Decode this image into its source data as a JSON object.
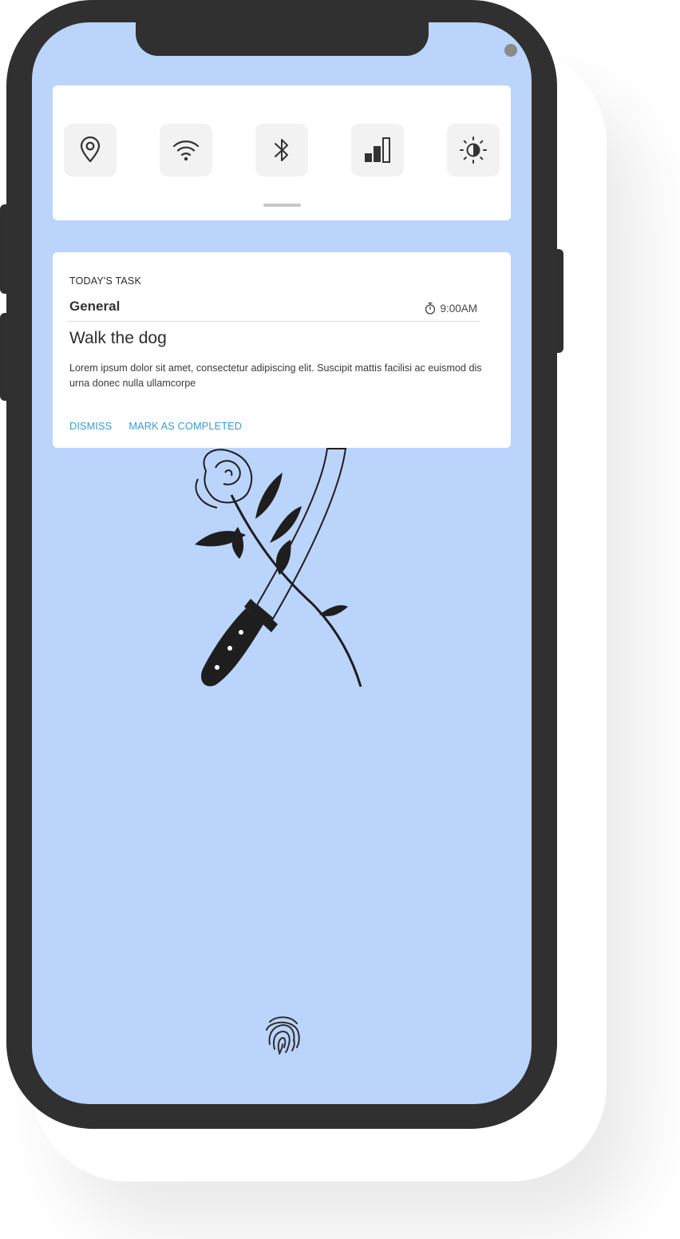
{
  "theme": {
    "screen_bg": "#bad4fb",
    "phone_frame": "#303030",
    "accent": "#3a9ad9"
  },
  "quick_settings": {
    "tiles": [
      {
        "icon": "location-icon"
      },
      {
        "icon": "wifi-icon"
      },
      {
        "icon": "bluetooth-icon"
      },
      {
        "icon": "signal-bars-icon"
      },
      {
        "icon": "brightness-icon"
      }
    ]
  },
  "notification": {
    "header": "TODAY'S TASK",
    "category": "General",
    "time": "9:00AM",
    "time_icon": "stopwatch-icon",
    "title": "Walk the dog",
    "body": "Lorem ipsum dolor sit amet, consectetur adipiscing elit. Suscipit mattis facilisi ac euismod dis urna donec nulla ullamcorpe",
    "actions": {
      "dismiss": "DISMISS",
      "complete": "MARK AS COMPLETED"
    }
  },
  "lockscreen": {
    "wallpaper": "rose-and-knife-illustration",
    "unlock_icon": "fingerprint-icon"
  }
}
